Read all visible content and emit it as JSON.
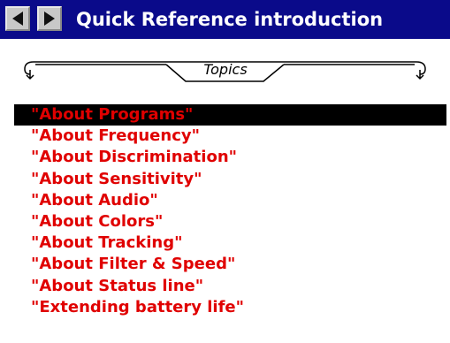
{
  "title": "Quick Reference introduction",
  "nav": {
    "back_icon": "left-arrow-icon",
    "forward_icon": "right-arrow-icon"
  },
  "topics_label": "Topics",
  "selected_index": 0,
  "colors": {
    "titlebar": "#0a0a8a",
    "link": "#e00000",
    "selection": "#000000"
  },
  "topics": [
    "\"About Programs\"",
    "\"About Frequency\"",
    "\"About Discrimination\"",
    "\"About Sensitivity\"",
    "\"About Audio\"",
    "\"About Colors\"",
    "\"About Tracking\"",
    "\"About Filter & Speed\"",
    "\"About Status line\"",
    "\"Extending battery life\""
  ]
}
